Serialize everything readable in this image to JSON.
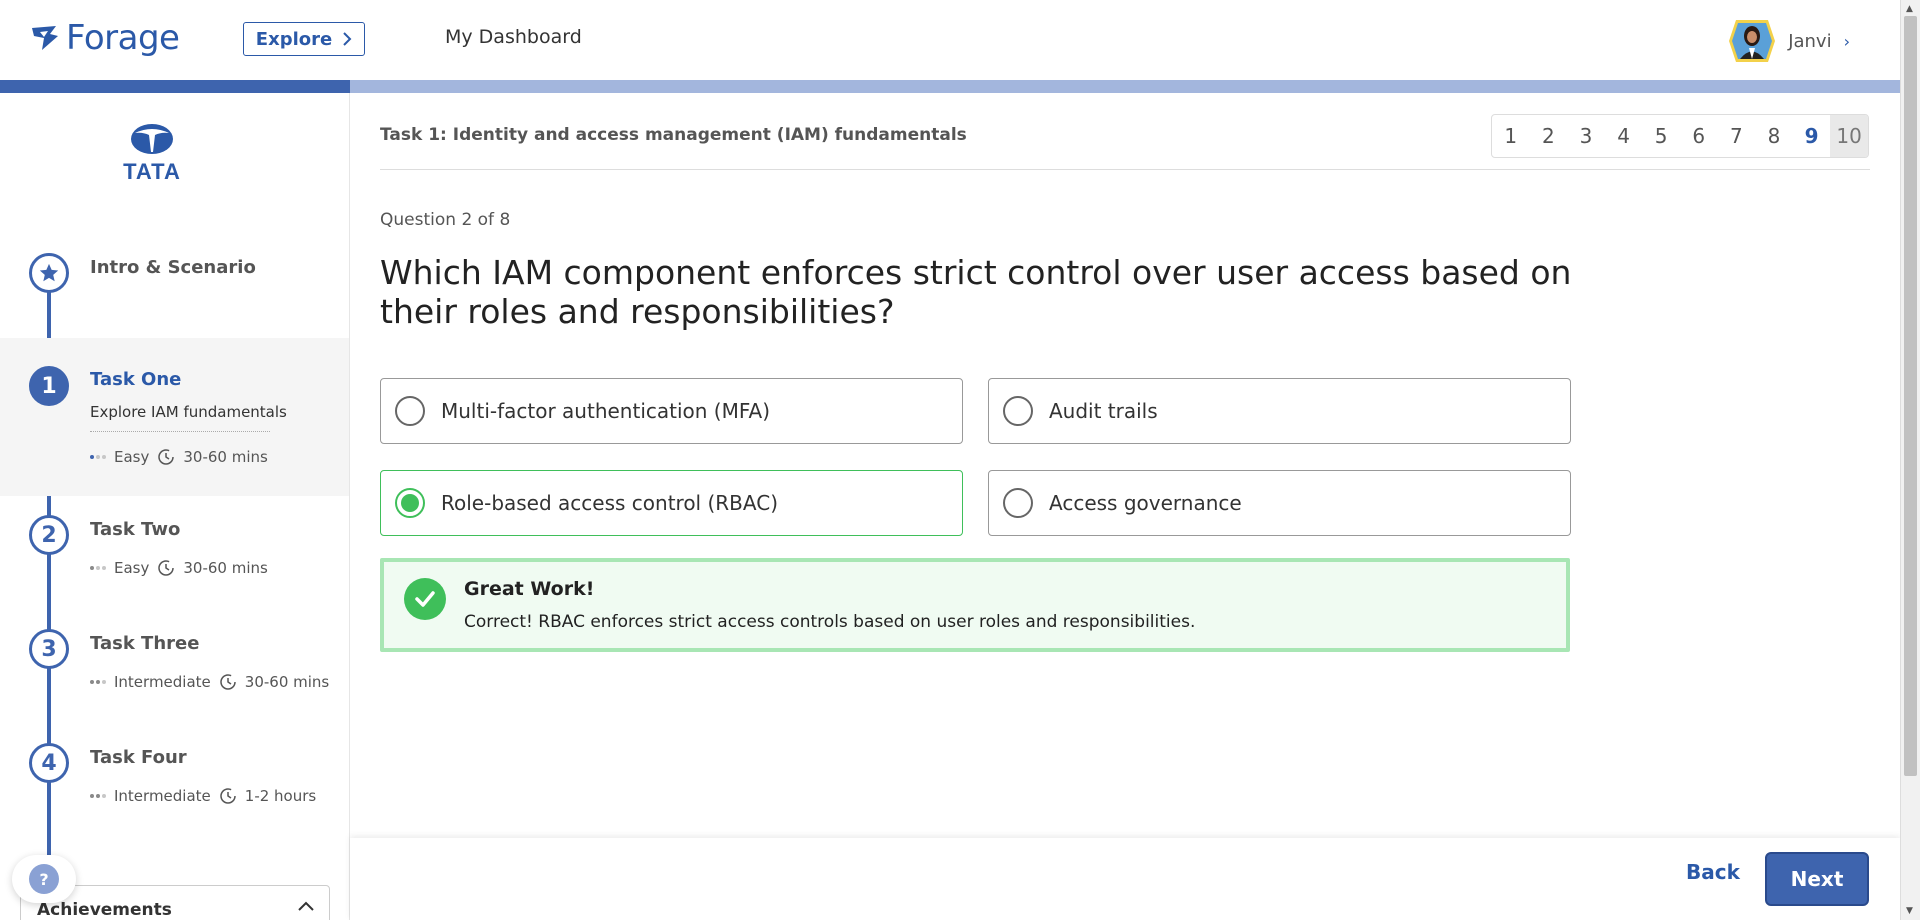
{
  "header": {
    "logo_text": "Forage",
    "explore_label": "Explore",
    "dashboard_label": "My Dashboard",
    "user_name": "Janvi"
  },
  "progress": {
    "fraction": 0.184
  },
  "sidebar": {
    "company": "TATA",
    "intro": {
      "title": "Intro & Scenario"
    },
    "tasks": [
      {
        "number": "1",
        "title": "Task One",
        "subtitle": "Explore IAM fundamentals",
        "difficulty": "Easy",
        "duration": "30-60 mins"
      },
      {
        "number": "2",
        "title": "Task Two",
        "difficulty": "Easy",
        "duration": "30-60 mins"
      },
      {
        "number": "3",
        "title": "Task Three",
        "difficulty": "Intermediate",
        "duration": "30-60 mins"
      },
      {
        "number": "4",
        "title": "Task Four",
        "difficulty": "Intermediate",
        "duration": "1-2 hours"
      }
    ],
    "help_label": "?",
    "achievements_label": "Achievements"
  },
  "main": {
    "task_header": "Task 1: Identity and access management (IAM) fundamentals",
    "pages": [
      "1",
      "2",
      "3",
      "4",
      "5",
      "6",
      "7",
      "8",
      "9",
      "10"
    ],
    "question_counter": "Question 2 of 8",
    "question": "Which IAM component enforces strict control over user access based on their roles and responsibilities?",
    "options": [
      "Multi-factor authentication (MFA)",
      "Audit trails",
      "Role-based access control (RBAC)",
      "Access governance"
    ],
    "feedback_title": "Great Work!",
    "feedback_text": "Correct! RBAC enforces strict access controls based on user roles and responsibilities."
  },
  "footer": {
    "back_label": "Back",
    "next_label": "Next"
  },
  "colors": {
    "brand": "#3e64ae",
    "success": "#3fbf5a",
    "success_bg": "#f0fbf2"
  }
}
